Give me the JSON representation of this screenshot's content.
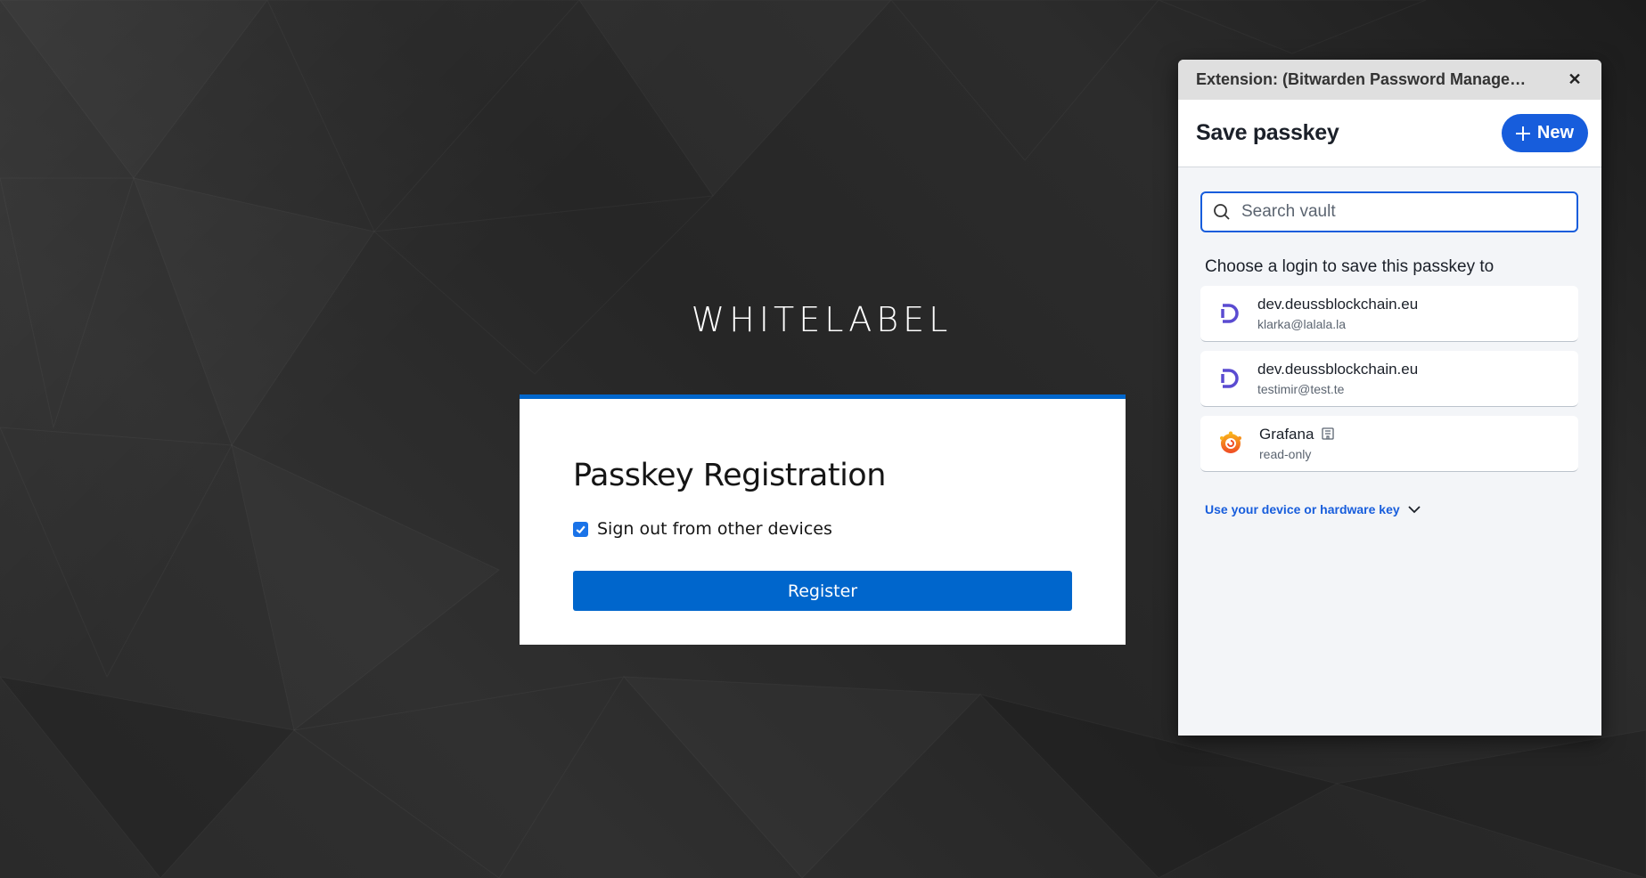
{
  "page": {
    "brand": "WHITELABEL",
    "card": {
      "title": "Passkey Registration",
      "checkbox_label": "Sign out from other devices",
      "checkbox_checked": true,
      "register_label": "Register"
    }
  },
  "extension": {
    "window_title": "Extension: (Bitwarden Password Manage…",
    "heading": "Save passkey",
    "new_label": "New",
    "search_placeholder": "Search vault",
    "choose_text": "Choose a login to save this passkey to",
    "logins": [
      {
        "name": "dev.deussblockchain.eu",
        "user": "klarka@lalala.la",
        "icon": "deuss-logo-icon"
      },
      {
        "name": "dev.deussblockchain.eu",
        "user": "testimir@test.te",
        "icon": "deuss-logo-icon"
      },
      {
        "name": "Grafana",
        "user": "read-only",
        "icon": "grafana-logo-icon"
      }
    ],
    "hardware_key_label": "Use your device or hardware key",
    "accent_color": "#175ddc"
  }
}
